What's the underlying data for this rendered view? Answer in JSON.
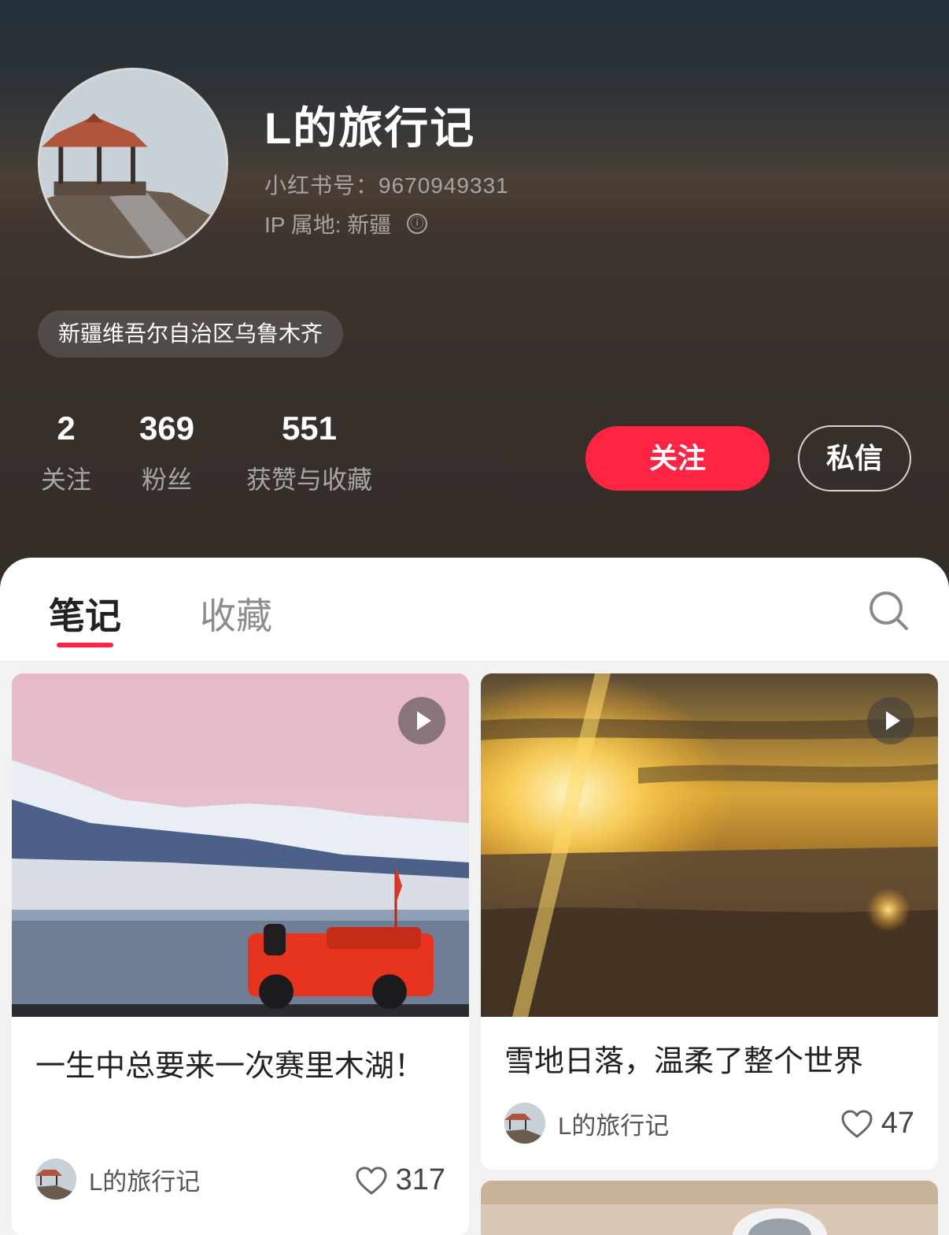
{
  "profile": {
    "name": "L的旅行记",
    "id_line": "小红书号：9670949331",
    "ip_line": "IP 属地: 新疆",
    "info_icon": "ⓘ",
    "location_tag": "新疆维吾尔自治区乌鲁木齐",
    "stats": [
      {
        "value": "2",
        "label": "关注"
      },
      {
        "value": "369",
        "label": "粉丝"
      },
      {
        "value": "551",
        "label": "获赞与收藏"
      }
    ],
    "follow_label": "关注",
    "message_label": "私信"
  },
  "tabs": [
    {
      "label": "笔记",
      "active": true
    },
    {
      "label": "收藏",
      "active": false
    }
  ],
  "notes": [
    {
      "title": "一生中总要来一次赛里木湖！",
      "author": "L的旅行记",
      "likes": "317",
      "is_video": true
    },
    {
      "title": "雪地日落，温柔了整个世界",
      "author": "L的旅行记",
      "likes": "47",
      "is_video": true
    }
  ],
  "colors": {
    "accent": "#ff2442",
    "header_bg": "#342d28"
  },
  "icons": [
    "info-icon",
    "search-icon",
    "play-icon",
    "heart-icon"
  ]
}
